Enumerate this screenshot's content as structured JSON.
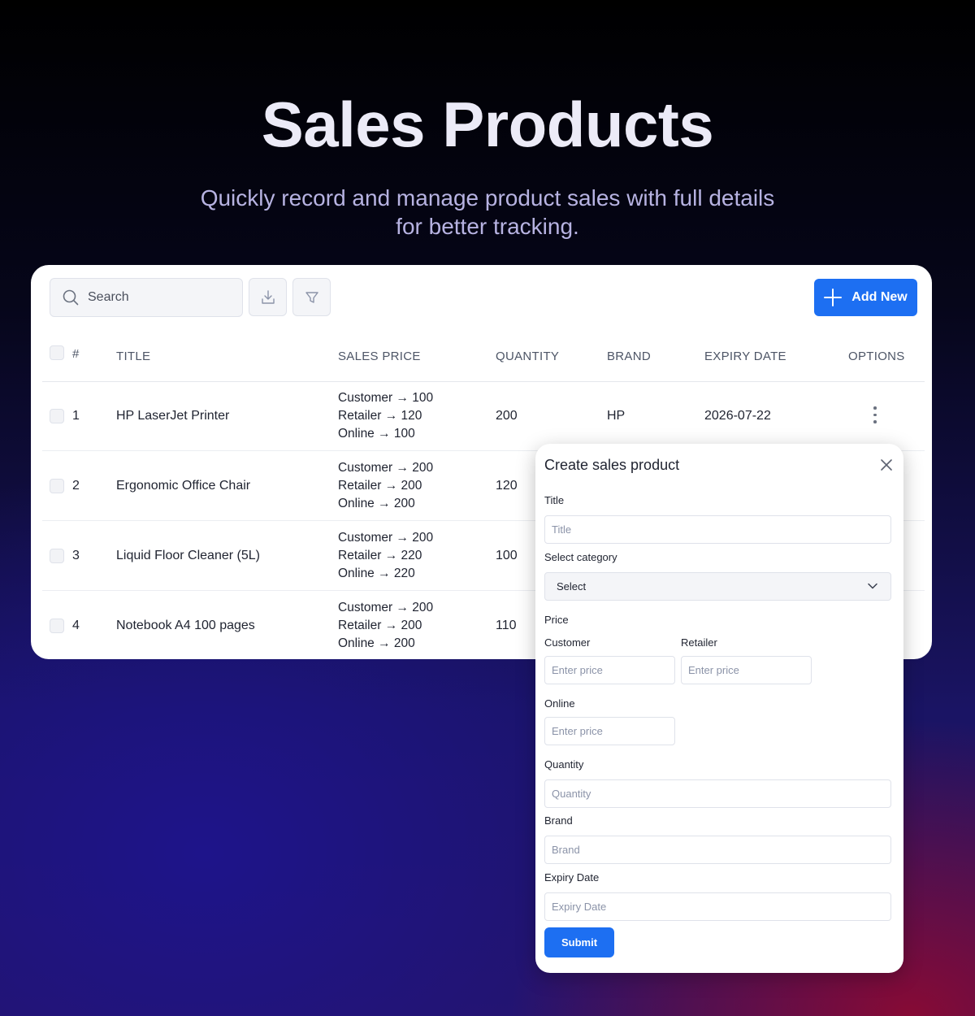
{
  "hero": {
    "title": "Sales Products",
    "subtitle_line1": "Quickly record and manage product sales with full details",
    "subtitle_line2": "for better tracking."
  },
  "toolbar": {
    "search_placeholder": "Search",
    "download_icon": "download-icon",
    "filter_icon": "filter-icon",
    "add_new_label": "Add New"
  },
  "table": {
    "headers": {
      "num": "#",
      "title": "TITLE",
      "sales_price": "SALES PRICE",
      "quantity": "QUANTITY",
      "brand": "BRAND",
      "expiry_date": "EXPIRY DATE",
      "options": "OPTIONS"
    },
    "rows": [
      {
        "num": "1",
        "title": "HP LaserJet Printer",
        "customer": "Customer → 100",
        "retailer": "Retailer → 120",
        "online": "Online → 100",
        "quantity": "200",
        "brand": "HP",
        "expiry": "2026-07-22"
      },
      {
        "num": "2",
        "title": "Ergonomic Office Chair",
        "customer": "Customer → 200",
        "retailer": "Retailer → 200",
        "online": "Online → 200",
        "quantity": "120",
        "brand": "",
        "expiry": ""
      },
      {
        "num": "3",
        "title": "Liquid Floor Cleaner (5L)",
        "customer": "Customer → 200",
        "retailer": "Retailer → 220",
        "online": "Online → 220",
        "quantity": "100",
        "brand": "",
        "expiry": ""
      },
      {
        "num": "4",
        "title": "Notebook A4 100 pages",
        "customer": "Customer → 200",
        "retailer": "Retailer → 200",
        "online": "Online → 200",
        "quantity": "110",
        "brand": "",
        "expiry": ""
      }
    ]
  },
  "modal": {
    "title": "Create sales product",
    "title_label": "Title",
    "title_placeholder": "Title",
    "category_label": "Select category",
    "category_value": "Select",
    "price_label": "Price",
    "customer_label": "Customer",
    "customer_placeholder": "Enter price",
    "retailer_label": "Retailer",
    "retailer_placeholder": "Enter price",
    "online_label": "Online",
    "online_placeholder": "Enter price",
    "quantity_label": "Quantity",
    "quantity_placeholder": "Quantity",
    "brand_label": "Brand",
    "brand_placeholder": "Brand",
    "expiry_label": "Expiry Date",
    "expiry_placeholder": "Expiry Date",
    "submit_label": "Submit"
  },
  "colors": {
    "accent": "#1d6ff2",
    "hero_title": "#ecebf7",
    "hero_subtitle": "#b7b3e2"
  }
}
